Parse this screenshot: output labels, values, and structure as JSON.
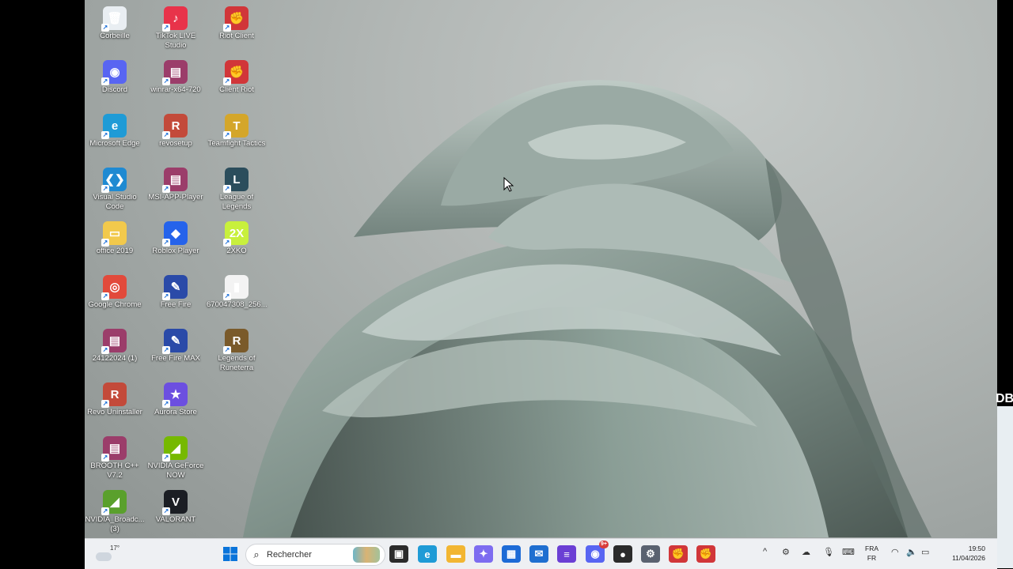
{
  "desktop": {
    "icons": [
      {
        "label": "Corbeille",
        "icon": "recycle-bin-icon",
        "color": "#e9eef2",
        "glyph": "🗑"
      },
      {
        "label": "Discord",
        "icon": "discord-icon",
        "color": "#5865f2",
        "glyph": "◉"
      },
      {
        "label": "Microsoft Edge",
        "icon": "edge-icon",
        "color": "#1f9bd6",
        "glyph": "e"
      },
      {
        "label": "Visual Studio Code",
        "icon": "vscode-icon",
        "color": "#1f8ad2",
        "glyph": "❮❯"
      },
      {
        "label": "office 2019",
        "icon": "folder-icon",
        "color": "#f2c94c",
        "glyph": "▭"
      },
      {
        "label": "Google Chrome",
        "icon": "chrome-icon",
        "color": "#e24a3b",
        "glyph": "◎"
      },
      {
        "label": "24122024 (1)",
        "icon": "winrar-icon",
        "color": "#9b3d6a",
        "glyph": "▤"
      },
      {
        "label": "Revo Uninstaller",
        "icon": "revo-icon",
        "color": "#c34a3a",
        "glyph": "R"
      },
      {
        "label": "BROOTH C++ V7.2",
        "icon": "winrar-icon",
        "color": "#9b3d6a",
        "glyph": "▤"
      },
      {
        "label": "NVIDIA_Broadc... (3)",
        "icon": "nvidia-icon",
        "color": "#5aa02c",
        "glyph": "◢"
      },
      {
        "label": "TikTok LIVE Studio",
        "icon": "tiktok-icon",
        "color": "#e8334a",
        "glyph": "♪"
      },
      {
        "label": "winrar-x64-720",
        "icon": "winrar-icon",
        "color": "#9b3d6a",
        "glyph": "▤"
      },
      {
        "label": "revosetup",
        "icon": "revo-icon",
        "color": "#c34a3a",
        "glyph": "R"
      },
      {
        "label": "MSI-APP-Player",
        "icon": "winrar-icon",
        "color": "#9b3d6a",
        "glyph": "▤"
      },
      {
        "label": "Roblox Player",
        "icon": "roblox-icon",
        "color": "#2563eb",
        "glyph": "◆"
      },
      {
        "label": "Free Fire",
        "icon": "free-fire-icon",
        "color": "#2a4aa8",
        "glyph": "✎"
      },
      {
        "label": "Free Fire MAX",
        "icon": "free-fire-icon",
        "color": "#2a4aa8",
        "glyph": "✎"
      },
      {
        "label": "Aurora Store",
        "icon": "aurora-store-icon",
        "color": "#6c4fe0",
        "glyph": "★"
      },
      {
        "label": "NVIDIA GeForce NOW",
        "icon": "nvidia-icon",
        "color": "#76b900",
        "glyph": "◢"
      },
      {
        "label": "VALORANT",
        "icon": "valorant-icon",
        "color": "#1b1e24",
        "glyph": "V"
      },
      {
        "label": "Riot Client",
        "icon": "riot-client-icon",
        "color": "#d13639",
        "glyph": "✊"
      },
      {
        "label": "Client Riot",
        "icon": "riot-client-icon",
        "color": "#d13639",
        "glyph": "✊"
      },
      {
        "label": "Teamfight Tactics",
        "icon": "tft-icon",
        "color": "#d4a62a",
        "glyph": "T"
      },
      {
        "label": "League of Legends",
        "icon": "league-icon",
        "color": "#2b4d5c",
        "glyph": "L"
      },
      {
        "label": "2XKO",
        "icon": "2xko-icon",
        "color": "#c8f03c",
        "glyph": "2X"
      },
      {
        "label": "670047308_256...",
        "icon": "file-icon",
        "color": "#f3f3f3",
        "glyph": "▮"
      },
      {
        "label": "Legends of Runeterra",
        "icon": "runeterra-icon",
        "color": "#7a5a2a",
        "glyph": "R"
      }
    ]
  },
  "taskbar": {
    "weather": {
      "temp": "17°",
      "icon": "weather-cloud-icon"
    },
    "start": {
      "icon": "windows-start-icon",
      "color": "#0a74da"
    },
    "search": {
      "placeholder": "Rechercher",
      "icon": "search-icon"
    },
    "pinned": [
      {
        "icon": "task-view-icon",
        "color": "#2b2b2b",
        "glyph": "▣"
      },
      {
        "icon": "edge-icon",
        "color": "#1f9bd6",
        "glyph": "e"
      },
      {
        "icon": "file-explorer-icon",
        "color": "#f2b632",
        "glyph": "▬"
      },
      {
        "icon": "copilot-icon",
        "color": "#7d6cf0",
        "glyph": "✦"
      },
      {
        "icon": "microsoft-store-icon",
        "color": "#1d6bd6",
        "glyph": "▦"
      },
      {
        "icon": "outlook-icon",
        "color": "#1f6fd0",
        "glyph": "✉"
      },
      {
        "icon": "clipchamp-icon",
        "color": "#6b3fd4",
        "glyph": "≡"
      },
      {
        "icon": "discord-icon",
        "color": "#5865f2",
        "glyph": "◉",
        "badge": "9+"
      },
      {
        "icon": "obs-icon",
        "color": "#2b2b2b",
        "glyph": "●"
      },
      {
        "icon": "settings-icon",
        "color": "#5a6270",
        "glyph": "⚙"
      },
      {
        "icon": "riot-client-icon",
        "color": "#d13639",
        "glyph": "✊"
      },
      {
        "icon": "riot-client-icon",
        "color": "#d13639",
        "glyph": "✊"
      }
    ],
    "tray": {
      "chevron": "^",
      "language_top": "FRA",
      "language_bottom": "FR",
      "time": "19:50",
      "date": "11/04/2026"
    }
  },
  "overlay": {
    "edge_text": "DB"
  }
}
